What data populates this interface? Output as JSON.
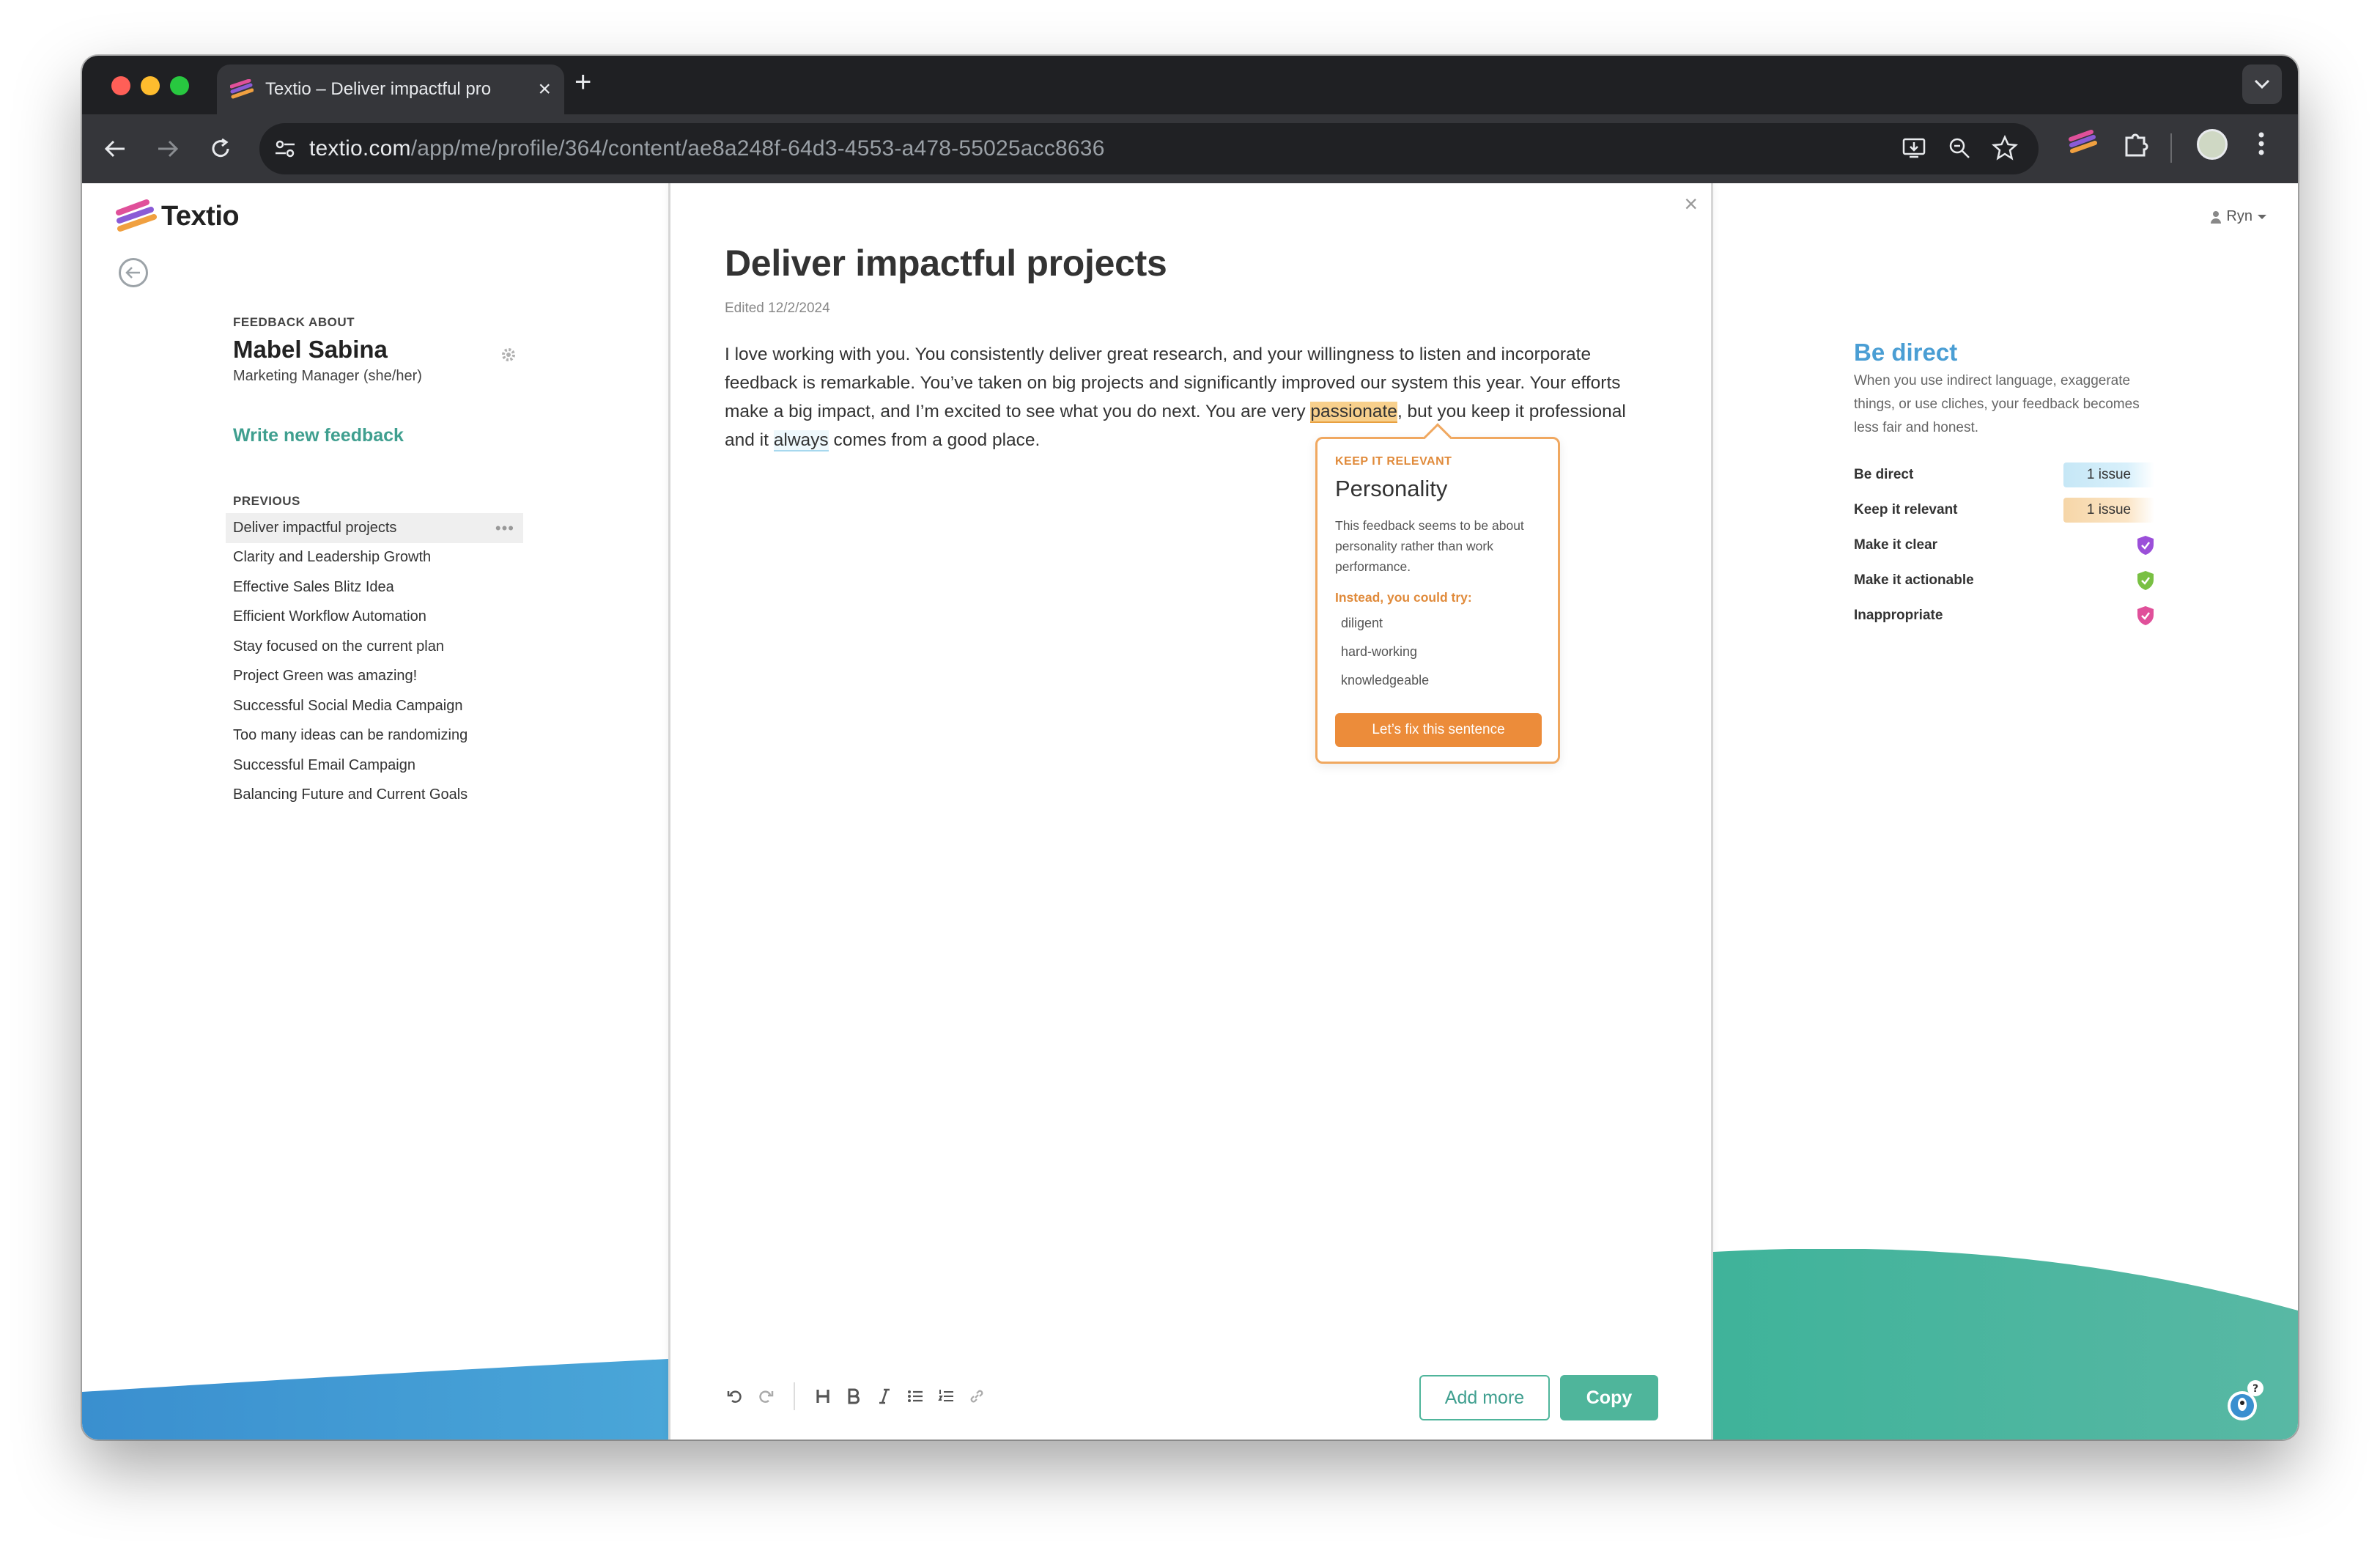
{
  "browser": {
    "tab_title": "Textio – Deliver impactful pro",
    "url_host": "textio.com",
    "url_path": "/app/me/profile/364/content/ae8a248f-64d3-4553-a478-55025acc8636"
  },
  "app": {
    "brand": "Textio",
    "user_name": "Ryn"
  },
  "sidebar": {
    "feedback_about_label": "FEEDBACK ABOUT",
    "person_name": "Mabel Sabina",
    "person_role": "Marketing Manager (she/her)",
    "write_new_label": "Write new feedback",
    "previous_label": "PREVIOUS",
    "previous_items": [
      "Deliver impactful projects",
      "Clarity and Leadership Growth",
      "Effective Sales Blitz Idea",
      "Efficient Workflow Automation",
      "Stay focused on the current plan",
      "Project Green was amazing!",
      "Successful Social Media Campaign",
      "Too many ideas can be randomizing",
      "Successful Email Campaign",
      "Balancing Future and Current Goals"
    ],
    "more_glyph": "•••"
  },
  "editor": {
    "title": "Deliver impactful projects",
    "edited": "Edited 12/2/2024",
    "body_part1": "I love working with you. You consistently deliver great research, and your willingness to listen and incorporate feedback is remarkable. You’ve taken on big projects and significantly improved our system this year. Your efforts make a big impact, and I’m excited to see what you do next. You are very ",
    "body_flagged": "passionate",
    "body_part2": ", but you keep it professional and it ",
    "body_flagged2": "always",
    "body_part3": " comes from a good place.",
    "add_more_label": "Add more",
    "copy_label": "Copy"
  },
  "popover": {
    "category": "KEEP IT RELEVANT",
    "title": "Personality",
    "description": "This feedback seems to be about personality rather than work performance.",
    "try_label": "Instead, you could try:",
    "suggestions": [
      "diligent",
      "hard-working",
      "knowledgeable"
    ],
    "button_label": "Let’s fix this sentence"
  },
  "guidance": {
    "title": "Be direct",
    "description": "When you use indirect language, exaggerate things, or use cliches, your feedback becomes less fair and honest.",
    "checks": [
      {
        "label": "Be direct",
        "badge": "1 issue",
        "color": "#c6e7f6"
      },
      {
        "label": "Keep it relevant",
        "badge": "1 issue",
        "color": "#f6d6a8"
      },
      {
        "label": "Make it clear",
        "icon": "shield-check-icon",
        "color": "#9b4fd9"
      },
      {
        "label": "Make it actionable",
        "icon": "shield-check-icon",
        "color": "#79c043"
      },
      {
        "label": "Inappropriate",
        "icon": "shield-check-icon",
        "color": "#e0509a"
      }
    ]
  },
  "colors": {
    "accent_teal": "#4fb59b",
    "accent_orange": "#ec8c3a",
    "accent_blue": "#4a9ed4"
  }
}
